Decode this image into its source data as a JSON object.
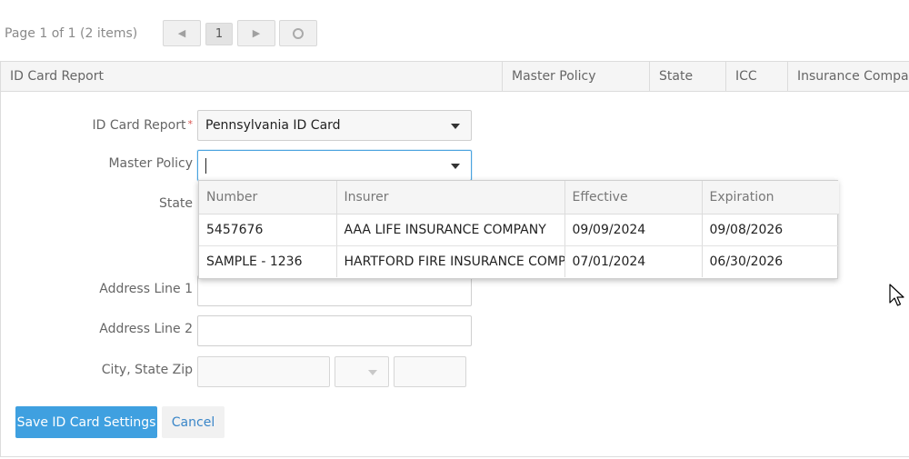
{
  "pager": {
    "info": "Page 1 of 1 (2 items)",
    "current_page": "1"
  },
  "grid": {
    "columns": [
      "ID Card Report",
      "Master Policy",
      "State",
      "ICC",
      "Insurance Company"
    ]
  },
  "form": {
    "id_card_report_label": "ID Card Report",
    "required_mark": "*",
    "id_card_report_value": "Pennsylvania ID Card",
    "master_policy_label": "Master Policy",
    "master_policy_value": "",
    "state_label": "State",
    "address1_label": "Address Line 1",
    "address2_label": "Address Line 2",
    "city_state_zip_label": "City, State Zip",
    "save_label": "Save ID Card Settings",
    "cancel_label": "Cancel"
  },
  "policy_dropdown": {
    "headers": [
      "Number",
      "Insurer",
      "Effective",
      "Expiration"
    ],
    "rows": [
      [
        "5457676",
        "AAA LIFE INSURANCE COMPANY",
        "09/09/2024",
        "09/08/2026"
      ],
      [
        "SAMPLE - 1236",
        "HARTFORD FIRE INSURANCE COMPANY",
        "07/01/2024",
        "06/30/2026"
      ]
    ]
  },
  "colors": {
    "primary_button": "#3fa0e0",
    "link": "#3a86c8",
    "required": "#d9534f"
  }
}
